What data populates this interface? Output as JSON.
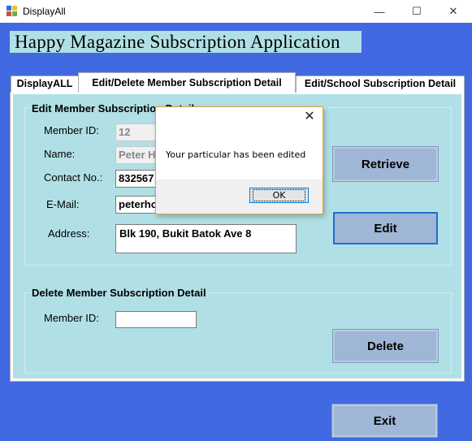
{
  "window": {
    "title": "DisplayAll",
    "min_glyph": "—",
    "max_glyph": "☐",
    "close_glyph": "✕"
  },
  "app": {
    "heading": "Happy Magazine Subscription Application"
  },
  "tabs": [
    {
      "label": "DisplayALL",
      "selected": false
    },
    {
      "label": "Edit/Delete Member Subscription Detail",
      "selected": true
    },
    {
      "label": "Edit/School Subscription Detail",
      "selected": false
    }
  ],
  "edit_section": {
    "title": "Edit Member Subscription Detail",
    "member_id_label": "Member ID:",
    "member_id_value": "12",
    "name_label": "Name:",
    "name_value": "Peter H",
    "contact_label": "Contact No.:",
    "contact_value": "832567",
    "email_label": "E-Mail:",
    "email_value": "peterho",
    "address_label": "Address:",
    "address_value": "Blk 190, Bukit Batok Ave 8",
    "retrieve_label": "Retrieve",
    "edit_label": "Edit"
  },
  "delete_section": {
    "title": "Delete Member Subscription Detail",
    "member_id_label": "Member ID:",
    "member_id_value": "",
    "delete_label": "Delete"
  },
  "exit_label": "Exit",
  "dialog": {
    "close_glyph": "✕",
    "message": "Your particular has been edited",
    "ok_label": "OK"
  },
  "colors": {
    "background": "#4169e1",
    "panel": "#b0e0e6",
    "button": "#9fb6d6",
    "focus_border": "#1e6fcf"
  }
}
